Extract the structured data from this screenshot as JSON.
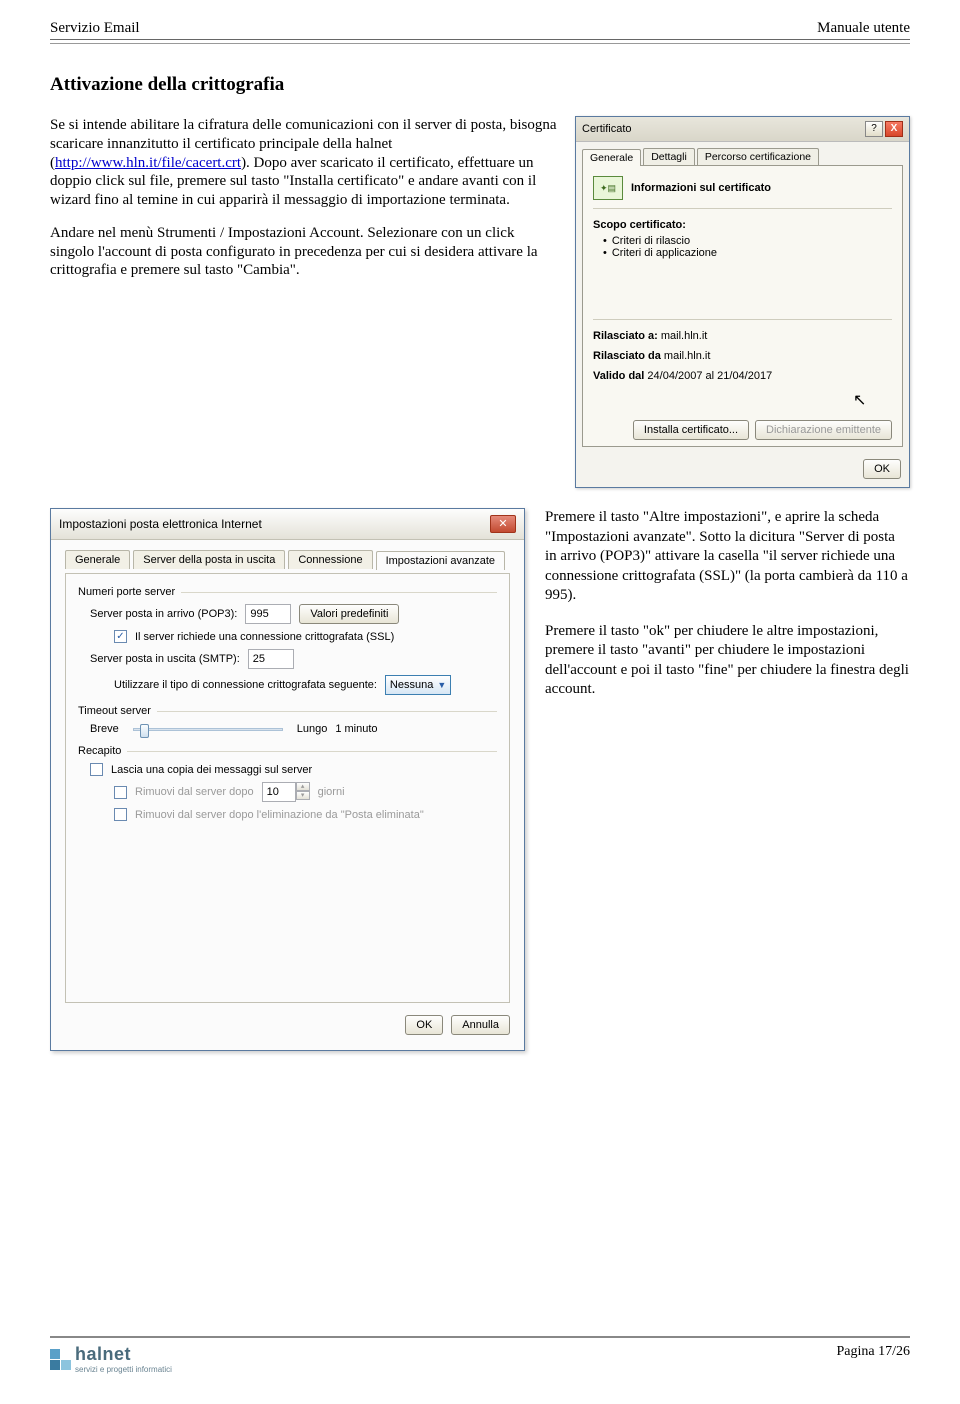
{
  "header": {
    "left": "Servizio Email",
    "right": "Manuale utente"
  },
  "section_title": "Attivazione della crittografia",
  "para1_a": "Se si intende abilitare la cifratura delle comunicazioni con il server di posta, bisogna scaricare innanzitutto il certificato principale della halnet (",
  "para1_link": "http://www.hln.it/file/cacert.crt",
  "para1_b": "). Dopo aver scaricato il certificato, effettuare un doppio click sul file, premere sul tasto \"Installa certificato\" e andare avanti con il wizard fino al temine in cui apparirà il messaggio di importazione terminata.",
  "para2": "Andare nel menù Strumenti / Impostazioni Account. Selezionare con un click singolo l'account di posta configurato in precedenza per cui si desidera attivare la crittografia e premere sul tasto \"Cambia\".",
  "cert": {
    "title": "Certificato",
    "tabs": [
      "Generale",
      "Dettagli",
      "Percorso certificazione"
    ],
    "info_heading": "Informazioni sul certificato",
    "scope_label": "Scopo certificato:",
    "bullets": [
      "Criteri di rilascio",
      "Criteri di applicazione"
    ],
    "issued_to_label": "Rilasciato a:",
    "issued_to": "mail.hln.it",
    "issued_by_label": "Rilasciato da",
    "issued_by": "mail.hln.it",
    "valid_label": "Valido dal",
    "valid_value": "24/04/2007 al 21/04/2017",
    "install_btn": "Installa certificato...",
    "decl_btn": "Dichiarazione emittente",
    "ok": "OK"
  },
  "mail": {
    "title": "Impostazioni posta elettronica Internet",
    "tabs": [
      "Generale",
      "Server della posta in uscita",
      "Connessione",
      "Impostazioni avanzate"
    ],
    "ports_label": "Numeri porte server",
    "pop3_label": "Server posta in arrivo (POP3):",
    "pop3_value": "995",
    "defaults_btn": "Valori predefiniti",
    "ssl_label": "Il server richiede una connessione crittografata (SSL)",
    "smtp_label": "Server posta in uscita (SMTP):",
    "smtp_value": "25",
    "enc_type_label": "Utilizzare il tipo di connessione crittografata seguente:",
    "enc_type_value": "Nessuna",
    "timeout_label": "Timeout server",
    "breve": "Breve",
    "lungo": "Lungo",
    "timeout_value": "1 minuto",
    "delivery_label": "Recapito",
    "leave_copy": "Lascia una copia dei messaggi sul server",
    "remove_after_a": "Rimuovi dal server dopo",
    "remove_after_days": "10",
    "remove_after_b": "giorni",
    "remove_deleted": "Rimuovi dal server dopo l'eliminazione da \"Posta eliminata\"",
    "ok": "OK",
    "cancel": "Annulla"
  },
  "para3": "Premere il tasto \"Altre impostazioni\", e aprire la scheda \"Impostazioni avanzate\". Sotto la dicitura \"Server di posta in arrivo (POP3)\" attivare la casella \"il server richiede una connessione crittografata (SSL)\" (la porta cambierà da 110 a 995).",
  "para4": "Premere il tasto \"ok\" per chiudere le altre impostazioni, premere il tasto \"avanti\" per chiudere le impostazioni dell'account e poi il tasto \"fine\" per chiudere la finestra degli account.",
  "footer": {
    "brand": "halnet",
    "tagline": "servizi e progetti informatici",
    "page": "Pagina 17/26"
  }
}
